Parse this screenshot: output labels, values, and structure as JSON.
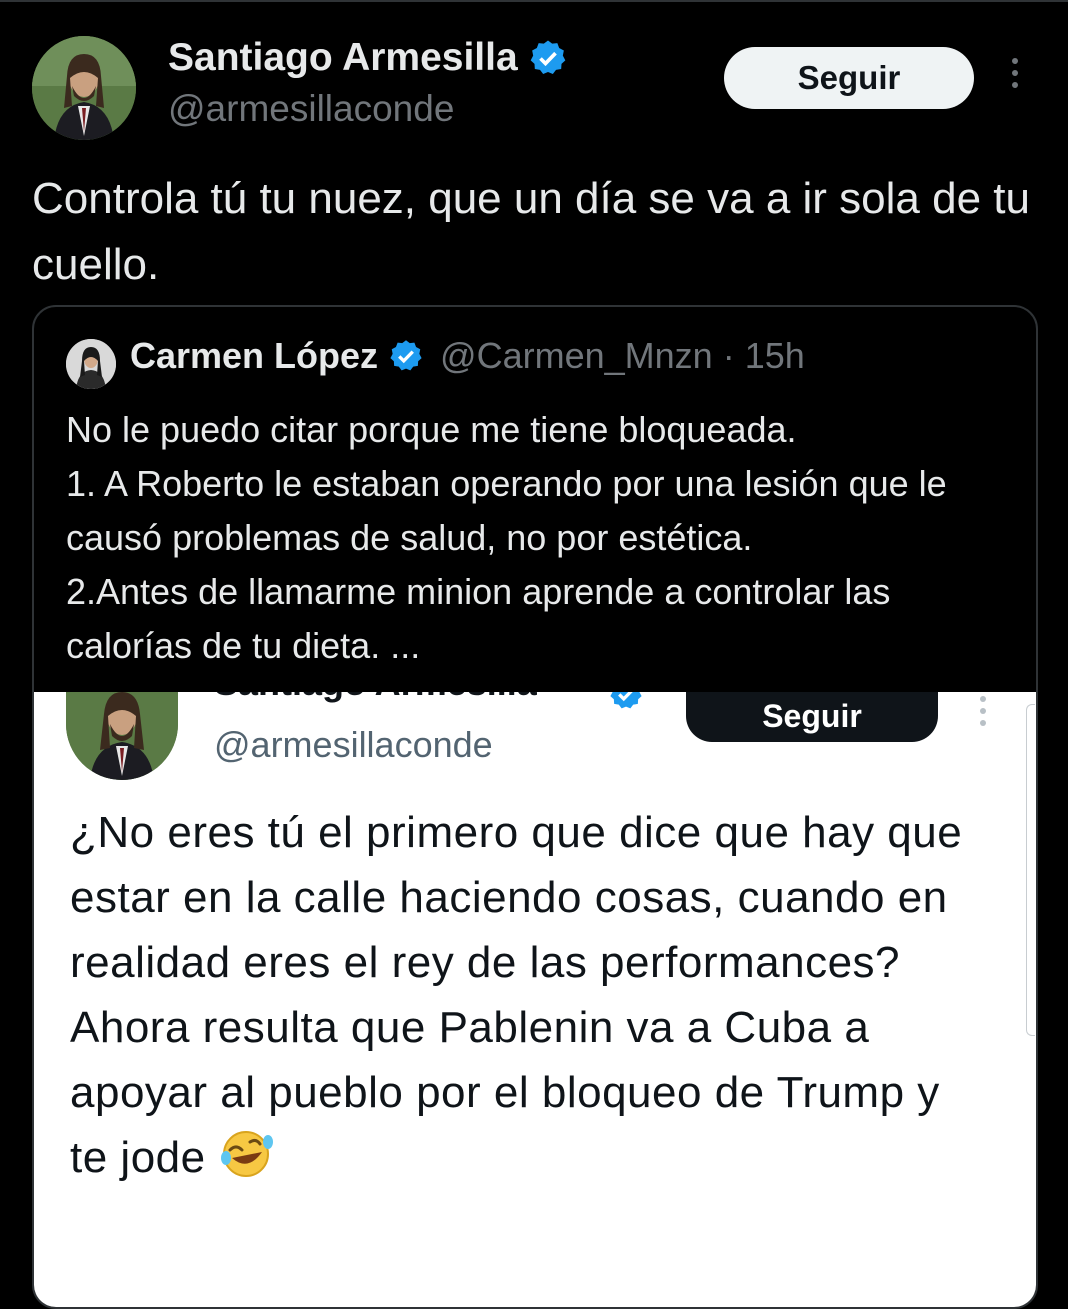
{
  "tweet": {
    "author_name": "Santiago Armesilla",
    "author_handle": "@armesillaconde",
    "follow_label": "Seguir",
    "text": "Controla tú tu nuez, que un día se va a ir sola de tu cuello."
  },
  "quoted": {
    "author_name": "Carmen López",
    "author_handle": "@Carmen_Mnzn",
    "separator": "·",
    "time": "15h",
    "lines": [
      "No le puedo citar porque me tiene bloqueada.",
      "1. A Roberto le estaban operando por una lesión que le causó problemas de salud, no por estética.",
      "2.Antes de llamarme minion aprende a controlar las calorías de tu dieta. ..."
    ]
  },
  "screenshot": {
    "author_name": "Santiago Armesilla",
    "author_handle": "@armesillaconde",
    "follow_label": "Seguir",
    "text": "¿No eres tú el primero que dice que hay que estar en la calle haciendo cosas, cuando en realidad eres el rey de las performances? Ahora resulta que Pablenin va a Cuba a apoyar al pueblo por el bloqueo de Trump y te jode",
    "emoji": "rolling-on-the-floor-laughing"
  },
  "colors": {
    "background": "#000000",
    "text_primary": "#e7e9ea",
    "text_secondary": "#71767b",
    "verified_blue": "#1d9bf0",
    "border": "#2f3336"
  }
}
